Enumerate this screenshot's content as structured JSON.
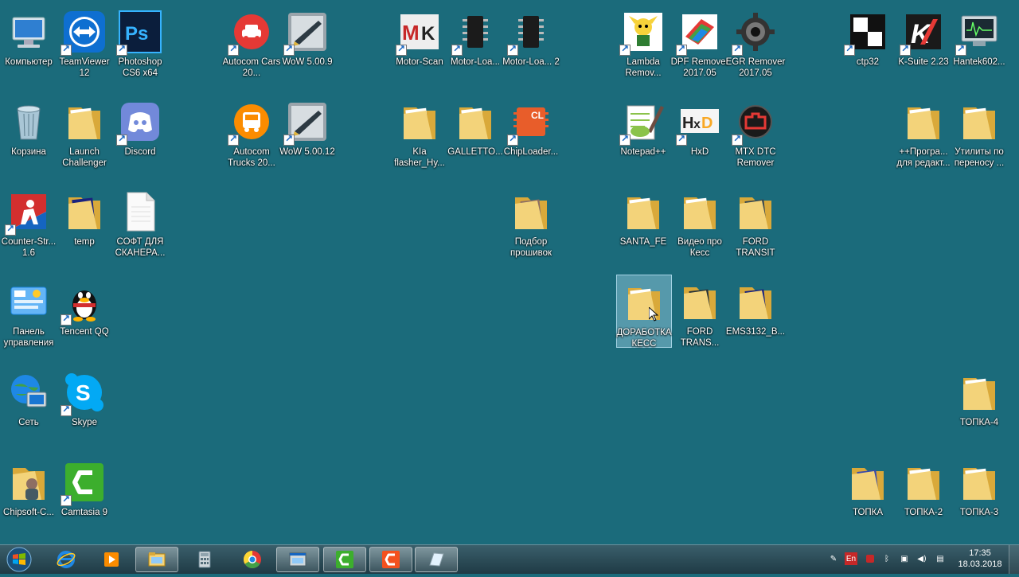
{
  "desktop": {
    "background": "#1b6b7b",
    "selected_icon": "Доработка Кесс",
    "icons": {
      "computer": "Компьютер",
      "teamviewer": "TeamViewer 12",
      "photoshop": "Photoshop CS6 x64",
      "autocom_cars": "Autocom Cars 20...",
      "wow_509": "WoW 5.00.9",
      "motor_scan": "Motor-Scan",
      "motor_loader": "Motor-Loa...",
      "motor_loader_2": "Motor-Loa... 2",
      "lambda": "Lambda Remov...",
      "dpf": "DPF Remover 2017.05",
      "egr": "EGR Remover 2017.05",
      "ctp32": "ctp32",
      "ksuite": "K-Suite 2.23",
      "hantek": "Hantek602...",
      "recycle": "Корзина",
      "launch": "Launch Challenger",
      "discord": "Discord",
      "autocom_trucks": "Autocom Trucks 20...",
      "wow_5012": "WoW 5.00.12",
      "kia": "KIa flasher_Hy...",
      "galletto": "GALLETTO...",
      "chiploader": "ChipLoader...",
      "notepad": "Notepad++",
      "hxd": "HxD",
      "mtx": "MTX DTC Remover",
      "programs_editor": "++Програ... для редакт...",
      "transfer_utils": "Утилиты по переносу ...",
      "cs16": "Counter-Str... 1.6",
      "temp": "temp",
      "soft_scanner": "СОФТ ДЛЯ СКАНЕРА...",
      "firmware": "Подбор прошивок",
      "santa_fe": "SANTA_FE",
      "video_kess": "Видео про Кесс",
      "ford_transit": "FORD TRANSIT",
      "control_panel": "Панель управления",
      "tencent": "Tencent QQ",
      "kess_mod": "ДОРАБОТКА КЕСС",
      "ford_trans": "FORD TRANS...",
      "ems3132": "EMS3132_B...",
      "network": "Сеть",
      "skype": "Skype",
      "topka4": "ТОПКА-4",
      "chipsoft": "Chipsoft-C...",
      "camtasia": "Camtasia 9",
      "topka": "ТОПКА",
      "topka2": "ТОПКА-2",
      "topka3": "ТОПКА-3"
    }
  },
  "taskbar": {
    "pinned": [
      "Start",
      "Internet Explorer",
      "Media Player",
      "Windows Explorer",
      "Calculator",
      "Google Chrome",
      "Screenshot",
      "Camtasia Recorder",
      "Camtasia Studio",
      "Notes"
    ],
    "language": "En",
    "time": "17:35",
    "date": "18.03.2018"
  }
}
